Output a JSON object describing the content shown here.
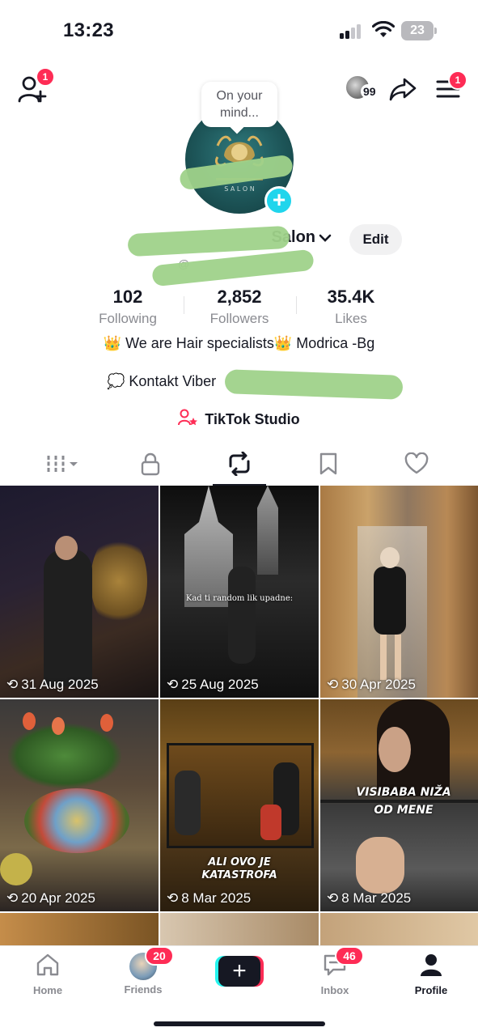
{
  "status_bar": {
    "time": "13:23",
    "battery": "23"
  },
  "header": {
    "add_friends_badge": "1",
    "menu_badge": "1",
    "viewers_count": "99"
  },
  "profile": {
    "bubble_text": "On your mind...",
    "display_name": "Salon",
    "username": "@",
    "edit_label": "Edit"
  },
  "stats": [
    {
      "value": "102",
      "label": "Following"
    },
    {
      "value": "2,852",
      "label": "Followers"
    },
    {
      "value": "35.4K",
      "label": "Likes"
    }
  ],
  "bio": {
    "line1": "👑 We are Hair specialists👑 Modrica -Bg",
    "line2": "💭 Kontakt  Viber",
    "studio_label": "TikTok Studio"
  },
  "tabs": [
    "videos",
    "private",
    "reposts",
    "favorites",
    "liked"
  ],
  "videos": [
    {
      "date": "31 Aug 2025",
      "text": ""
    },
    {
      "date": "25 Aug 2025",
      "text": "Kad ti random lik upadne:"
    },
    {
      "date": "30 Apr 2025",
      "text": ""
    },
    {
      "date": "20 Apr 2025",
      "text": ""
    },
    {
      "date": "8 Mar 2025",
      "text": "ALI OVO JE KATASTROFA"
    },
    {
      "date": "8 Mar 2025",
      "text": "VISIBABA NIŽA OD MENE"
    }
  ],
  "nav": {
    "home": "Home",
    "friends": "Friends",
    "friends_badge": "20",
    "inbox": "Inbox",
    "inbox_badge": "46",
    "profile": "Profile"
  },
  "colors": {
    "accent": "#fe2c55",
    "cyan": "#25f4ee",
    "text": "#161823",
    "muted": "#8a8b91"
  }
}
